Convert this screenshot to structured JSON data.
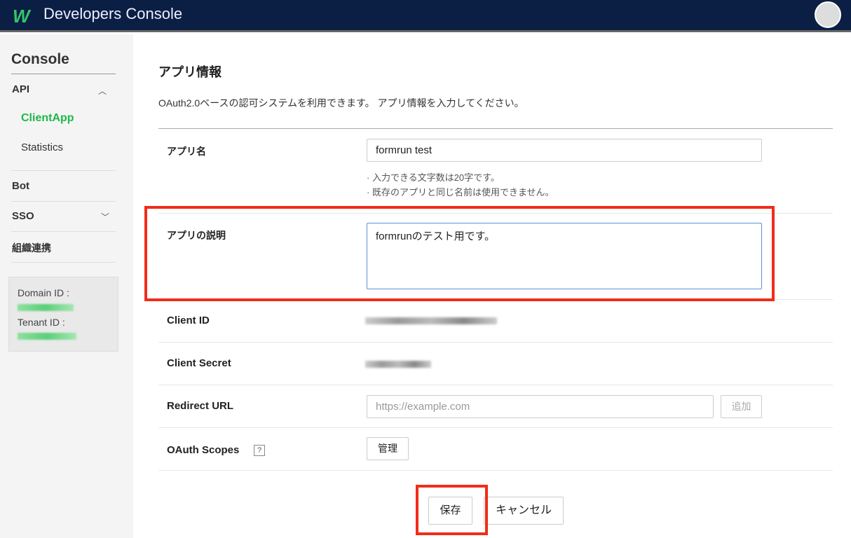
{
  "header": {
    "logo": "W",
    "title": "Developers Console"
  },
  "sidebar": {
    "heading": "Console",
    "items": [
      {
        "label": "API"
      },
      {
        "label": "ClientApp"
      },
      {
        "label": "Statistics"
      },
      {
        "label": "Bot"
      },
      {
        "label": "SSO"
      },
      {
        "label": "組織連携"
      }
    ],
    "domain_label": "Domain ID :",
    "tenant_label": "Tenant ID :"
  },
  "main": {
    "title": "アプリ情報",
    "description": "OAuth2.0ベースの認可システムを利用できます。 アプリ情報を入力してください。",
    "app_name": {
      "label": "アプリ名",
      "value": "formrun test",
      "hints": [
        "· 入力できる文字数は20字です。",
        "· 既存のアプリと同じ名前は使用できません。"
      ]
    },
    "app_desc": {
      "label": "アプリの説明",
      "value": "formrunのテスト用です。"
    },
    "client_id": {
      "label": "Client ID"
    },
    "client_secret": {
      "label": "Client Secret"
    },
    "redirect": {
      "label": "Redirect URL",
      "placeholder": "https://example.com",
      "add": "追加"
    },
    "scopes": {
      "label": "OAuth Scopes",
      "help": "?",
      "manage": "管理"
    },
    "save": "保存",
    "cancel": "キャンセル"
  },
  "colors": {
    "header": "#0b1f44",
    "accent": "#1fb84a",
    "highlight": "#f02d1a"
  }
}
